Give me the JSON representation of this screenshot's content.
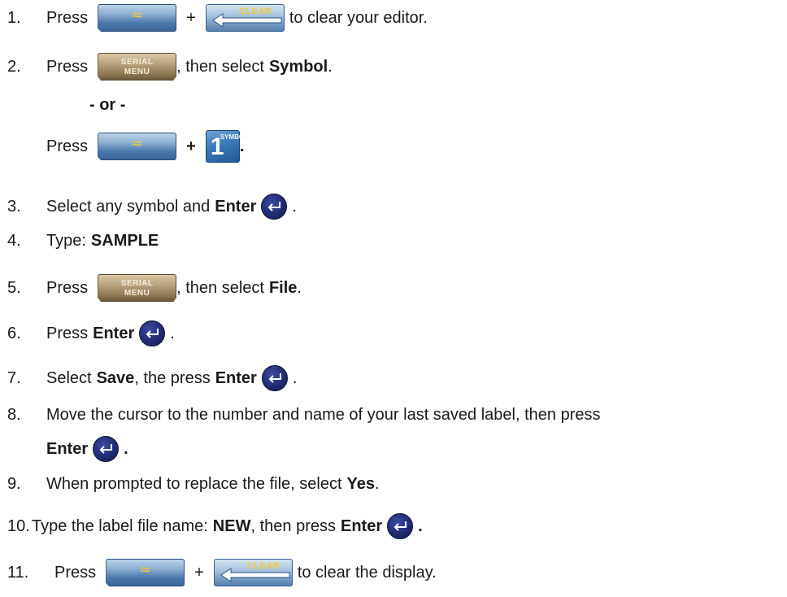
{
  "icons": {
    "shift_key": "shift-key-icon",
    "clear_key": "clear-key-icon",
    "serial_menu_key": "serial-menu-key-icon",
    "symbol_one_key": "one-symbol-key-icon",
    "enter_key": "enter-key-icon"
  },
  "key_labels": {
    "shift_glyph": "≈",
    "clear": "CLEAR",
    "serial": "SERIAL",
    "menu": "MENU",
    "one": "1",
    "symbol": "SYMBOL"
  },
  "steps": [
    {
      "number": "1.",
      "before": "Press",
      "plus": "+",
      "after": "to clear your editor."
    },
    {
      "number": "2.",
      "before": "Press",
      "middle": ", then select",
      "bold": "Symbol",
      "end": "."
    },
    {
      "or_text": "- or -"
    },
    {
      "before": "Press",
      "plus": "+",
      "end": "."
    },
    {
      "number": "3.",
      "before": "Select any symbol and",
      "bold": "Enter",
      "end": "."
    },
    {
      "number": "4.",
      "before": "Type:",
      "bold": "SAMPLE"
    },
    {
      "number": "5.",
      "before": "Press",
      "middle": ", then select",
      "bold": "File",
      "end": "."
    },
    {
      "number": "6.",
      "before": "Press",
      "bold": "Enter",
      "end": "."
    },
    {
      "number": "7.",
      "before": "Select",
      "bold": "Save",
      "middle": ", the press",
      "bold2": "Enter",
      "end": "."
    },
    {
      "number": "8.",
      "before": "Move the cursor to the number and name of your last saved label, then press",
      "bold": "Enter",
      "end": "."
    },
    {
      "number": "9.",
      "before": "When prompted to replace the file, select",
      "bold": "Yes",
      "end": "."
    },
    {
      "number": "10.",
      "before": "Type the label file name:",
      "bold": "NEW",
      "middle": ", then press",
      "bold2": "Enter",
      "end": "."
    },
    {
      "number": "11.",
      "before": "Press",
      "plus": "+",
      "after": "to clear the display."
    }
  ]
}
